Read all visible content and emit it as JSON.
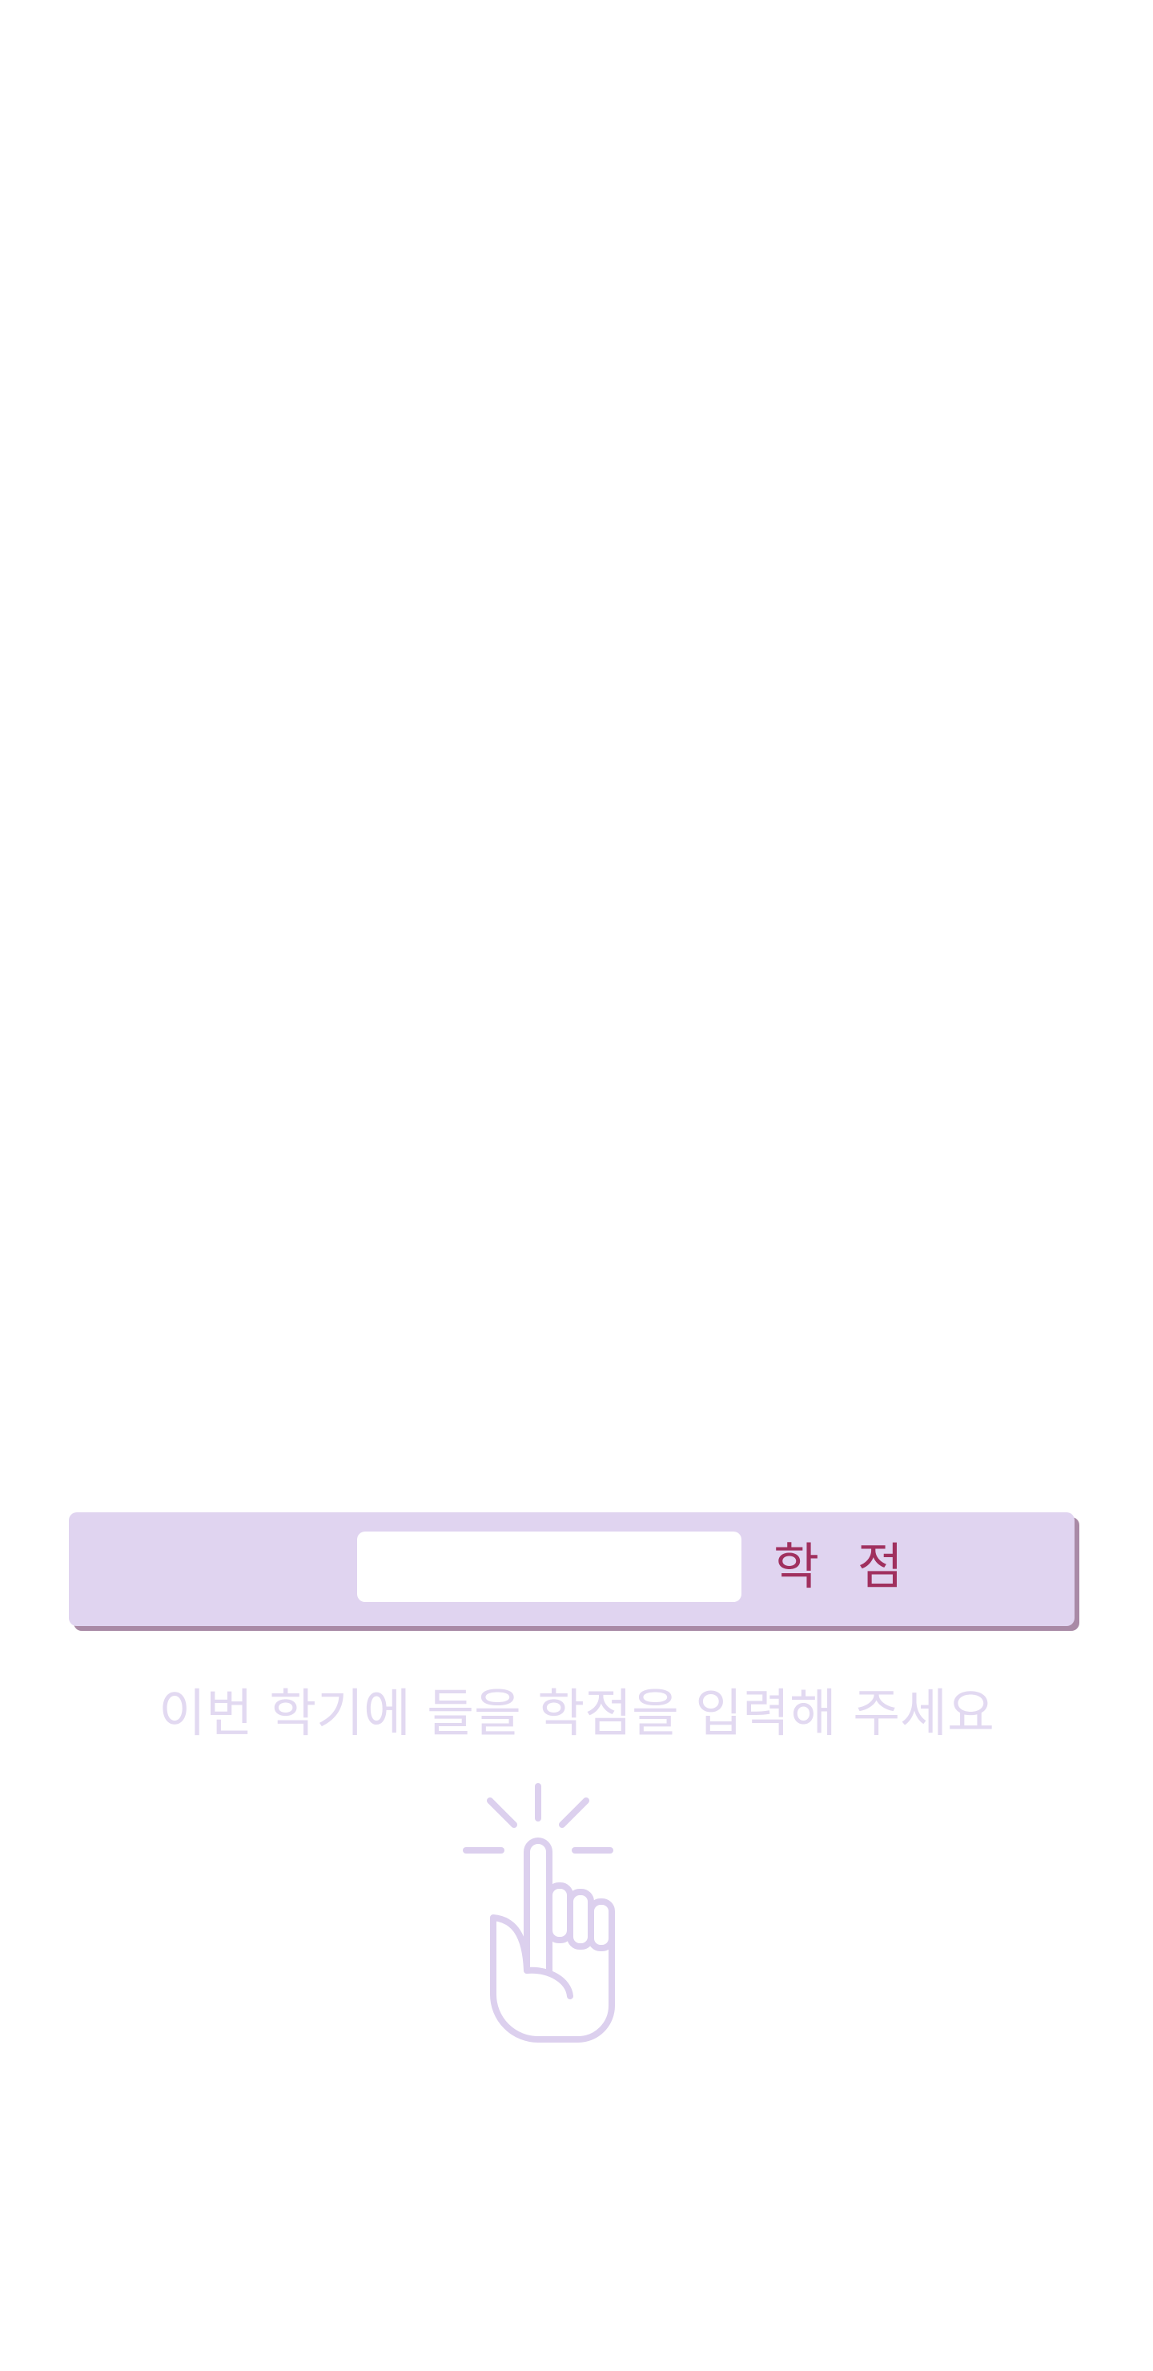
{
  "credit_input": {
    "value": "",
    "placeholder": "",
    "unit_label": "학 점"
  },
  "hint": {
    "text": "이번 학기에 들을 학점을 입력해 주세요"
  },
  "icons": {
    "tap": "hand-tap-icon"
  },
  "colors": {
    "bar_background": "#e0d4f0",
    "bar_shadow": "#a98aa6",
    "unit_label": "#a0305e",
    "hint_text": "#e2d9f1",
    "icon_stroke": "#dcd0ee"
  }
}
